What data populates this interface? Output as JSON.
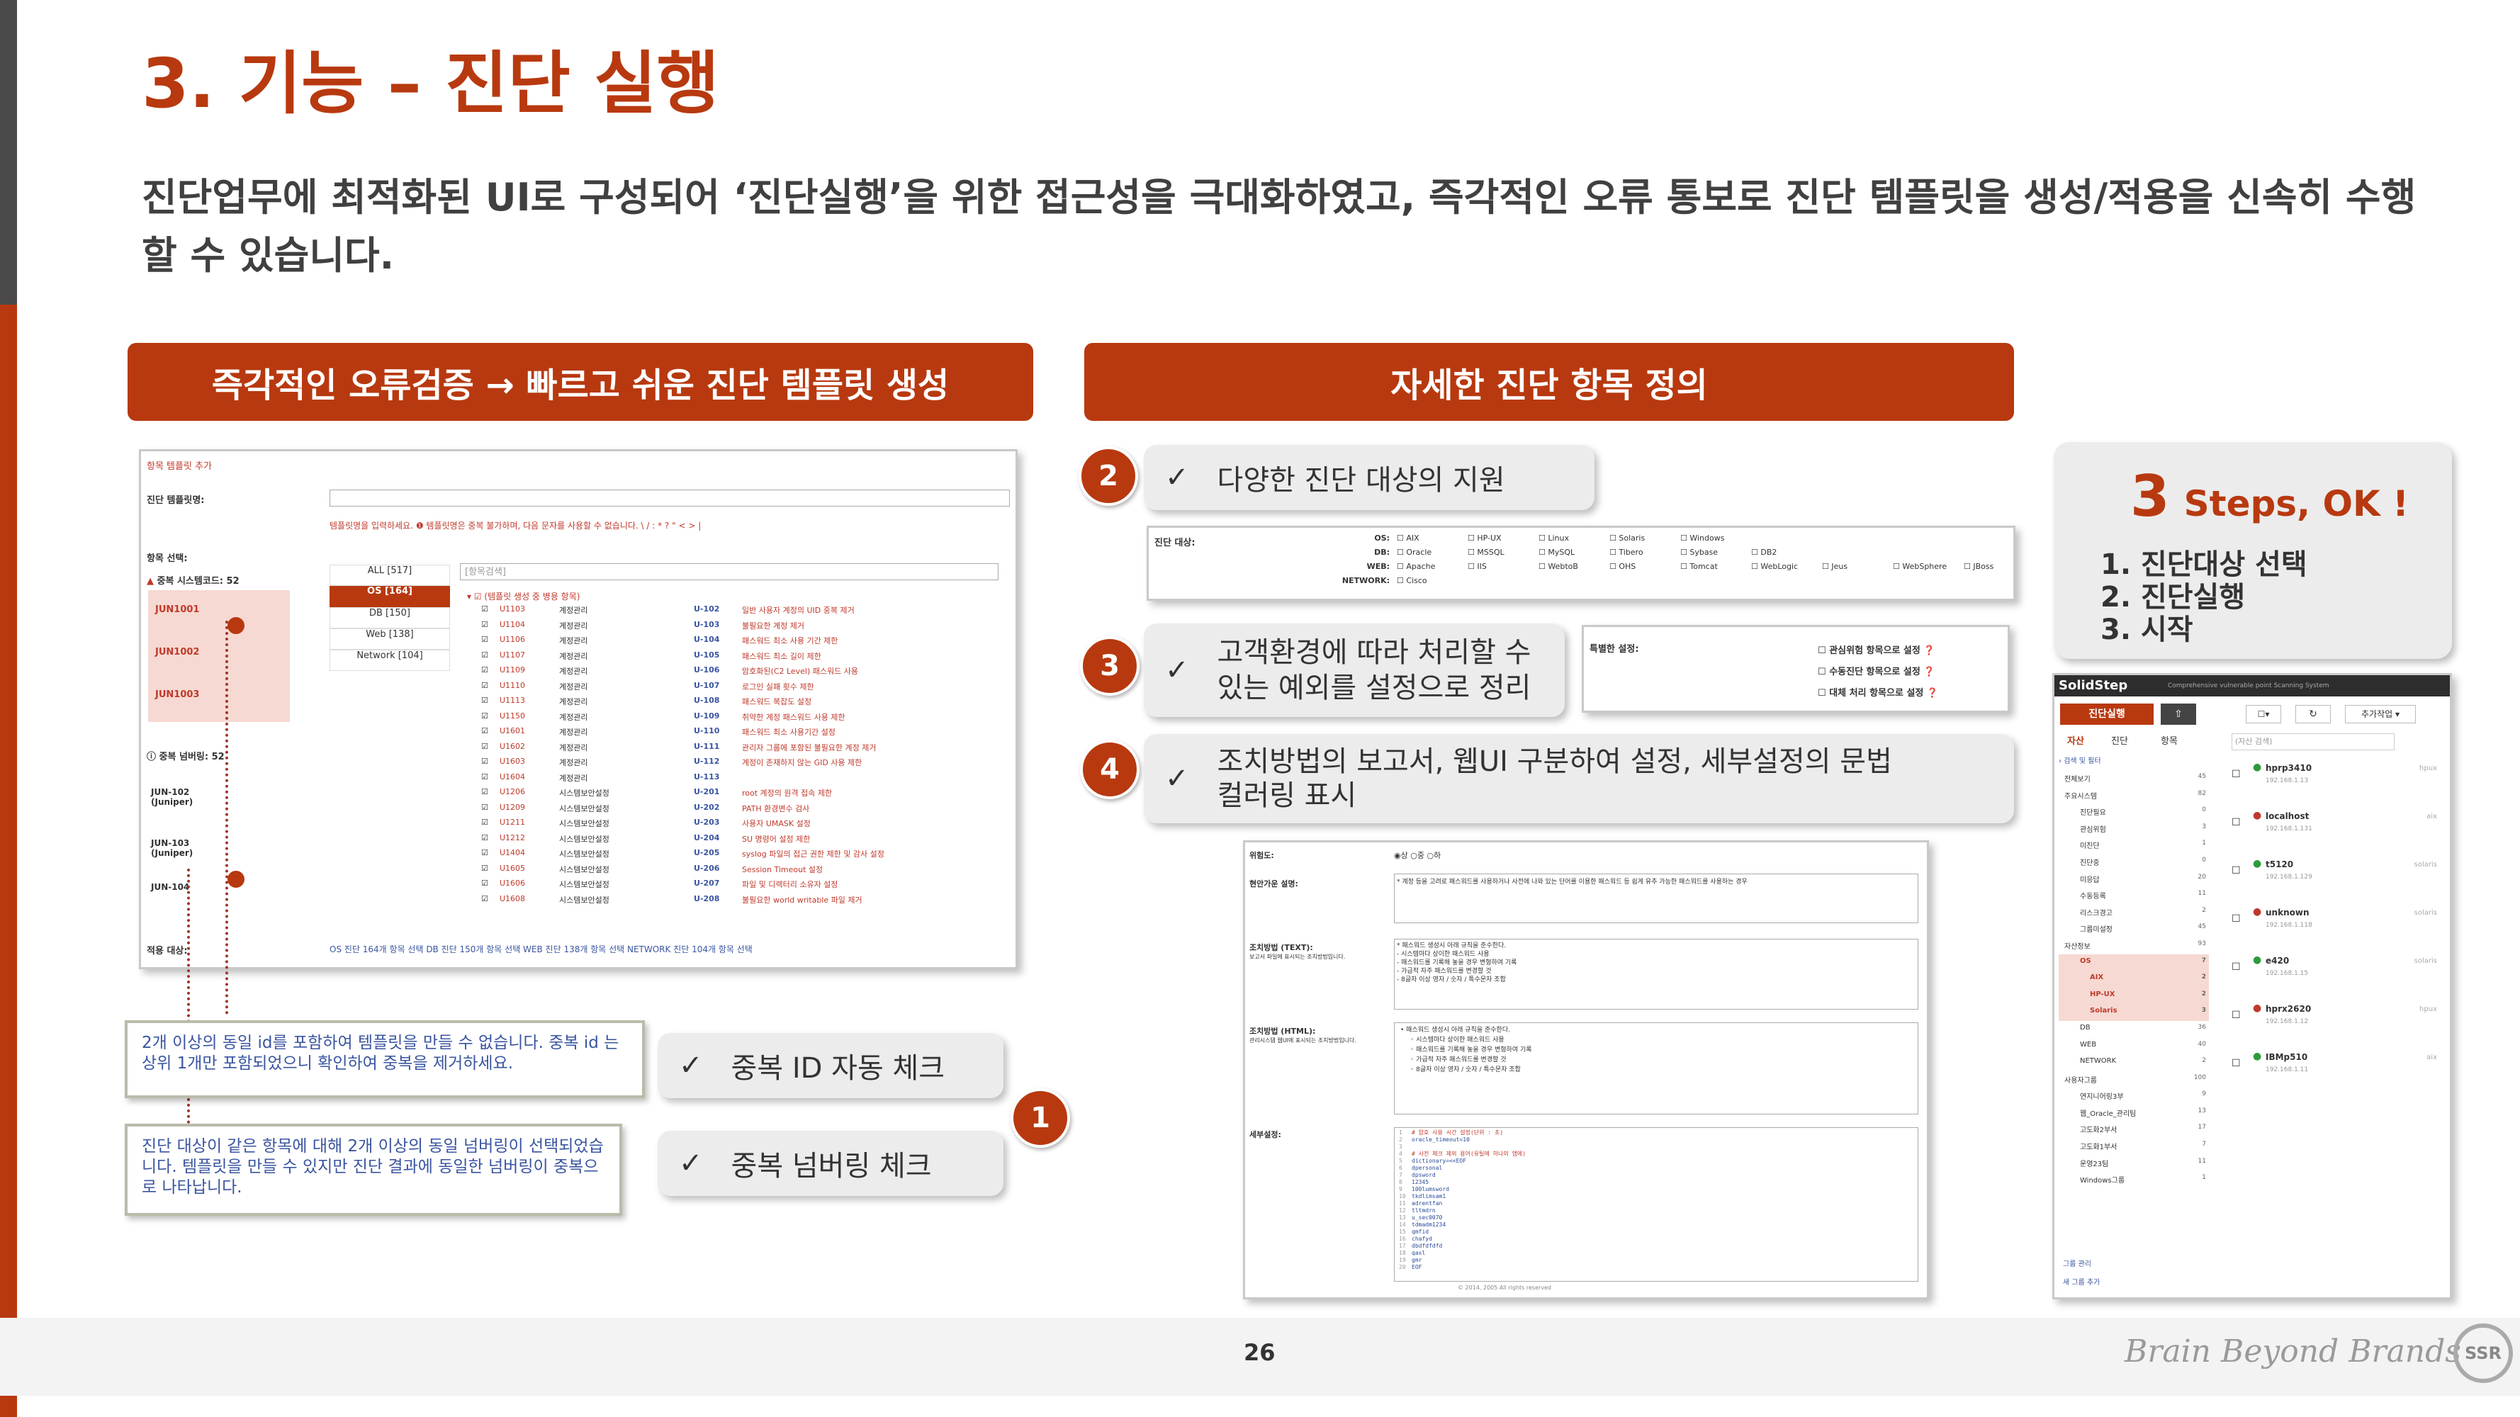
{
  "title": "3. 기능 – 진단 실행",
  "subtitle": "진단업무에 최적화된 UI로 구성되어 ‘진단실행’을 위한 접근성을 극대화하였고, 즉각적인 오류 통보로 진단 템플릿을 생성/적용을 신속히 수행할 수 있습니다.",
  "left_header": "즉각적인 오류검증 → 빠르고 쉬운 진단 템플릿 생성",
  "right_header": "자세한 진단 항목 정의",
  "template_screen": {
    "title": "항목 템플릿 추가",
    "name_label": "진단 템플릿명:",
    "name_hint": "템플릿명을 입력하세요. ❶ 템플릿명은 중복 불가하며, 다음 문자를 사용할 수 없습니다.",
    "name_hint_chars": "\\ / : * ? \" < > |",
    "item_select_label": "항목 선택:",
    "dup_code_label": "중복 시스템코드: 52",
    "dup_num_label": "중복 넘버링: 52",
    "search_placeholder": "[항목검색]",
    "tree_root": "(템플릿 생성 중 병용 항목)",
    "categories": [
      "ALL [517]",
      "OS [164]",
      "DB [150]",
      "Web [138]",
      "Network [104]"
    ],
    "dup_codes": [
      "JUN1001",
      "JUN1002",
      "JUN1003"
    ],
    "dup_nums": [
      "JUN-102 (Juniper)",
      "JUN-103 (Juniper)",
      "JUN-104"
    ],
    "apply_label": "적용 대상:",
    "apply_text": "OS 진단 164개 항목 선택 DB 진단 150개 항목 선택 WEB 진단 138개 항목 선택 NETWORK 진단 104개 항목 선택",
    "rows": [
      [
        "U1103",
        "계정관리",
        "U-102",
        "일반 사용자 계정의 UID 중복 제거"
      ],
      [
        "U1104",
        "계정관리",
        "U-103",
        "불필요한 계정 제거"
      ],
      [
        "U1106",
        "계정관리",
        "U-104",
        "패스워드 최소 사용 기간 제한"
      ],
      [
        "U1107",
        "계정관리",
        "U-105",
        "패스워드 최소 길이 제한"
      ],
      [
        "U1109",
        "계정관리",
        "U-106",
        "암호화된(C2 Level) 패스워드 사용"
      ],
      [
        "U1110",
        "계정관리",
        "U-107",
        "로그인 실패 횟수 제한"
      ],
      [
        "U1113",
        "계정관리",
        "U-108",
        "패스워드 복잡도 설정"
      ],
      [
        "U1150",
        "계정관리",
        "U-109",
        "취약한 계정 패스워드 사용 제한"
      ],
      [
        "U1601",
        "계정관리",
        "U-110",
        "패스워드 최소 사용기간 설정"
      ],
      [
        "U1602",
        "계정관리",
        "U-111",
        "관리자 그룹에 포함된 불필요한 계정 제거"
      ],
      [
        "U1603",
        "계정관리",
        "U-112",
        "계정이 존재하지 않는 GID 사용 제한"
      ],
      [
        "U1604",
        "계정관리",
        "U-113",
        ""
      ],
      [
        "U1206",
        "시스템보안설정",
        "U-201",
        "root 계정의 원격 접속 제한"
      ],
      [
        "U1209",
        "시스템보안설정",
        "U-202",
        "PATH 환경변수 검사"
      ],
      [
        "U1211",
        "시스템보안설정",
        "U-203",
        "사용자 UMASK 설정"
      ],
      [
        "U1212",
        "시스템보안설정",
        "U-204",
        "SU 명령어 설정 제한"
      ],
      [
        "U1404",
        "시스템보안설정",
        "U-205",
        "syslog 파일의 접근 권한 제한 및 감사 설정"
      ],
      [
        "U1605",
        "시스템보안설정",
        "U-206",
        "Session Timeout 설정"
      ],
      [
        "U1606",
        "시스템보안설정",
        "U-207",
        "파일 및 디렉터리 소유자 설정"
      ],
      [
        "U1608",
        "시스템보안설정",
        "U-208",
        "불필요한 world writable 파일 제거"
      ]
    ]
  },
  "note1": "2개 이상의 동일 id를 포함하여 템플릿을 만들 수 없습니다. 중복 id 는 상위 1개만 포함되었으니 확인하여 중복을 제거하세요.",
  "note2": "진단 대상이 같은 항목에 대해 2개 이상의 동일 넘버링이 선택되었습니다. 템플릿을 만들 수 있지만 진단 결과에 동일한 넘버링이 중복으로 나타납니다.",
  "callout_dup_id": "중복 ID 자동 체크",
  "callout_dup_num": "중복 넘버링 체크",
  "callout_targets": "다양한 진단 대상의 지원",
  "callout_exceptions_1": "고객환경에 따라 처리할 수",
  "callout_exceptions_2": "있는 예외를 설정으로 정리",
  "callout_report_1": "조치방법의 보고서, 웹UI 구분하여 설정, 세부설정의 문법",
  "callout_report_2": "컬러링 표시",
  "badges": [
    "1",
    "2",
    "3",
    "4"
  ],
  "targets_screen": {
    "label": "진단 대상:",
    "rows": [
      {
        "key": "OS:",
        "items": [
          "AIX",
          "HP-UX",
          "Linux",
          "Solaris",
          "Windows"
        ]
      },
      {
        "key": "DB:",
        "items": [
          "Oracle",
          "MSSQL",
          "MySQL",
          "Tibero",
          "Sybase",
          "DB2"
        ]
      },
      {
        "key": "WEB:",
        "items": [
          "Apache",
          "IIS",
          "WebtoB",
          "OHS",
          "Tomcat",
          "WebLogic",
          "Jeus",
          "WebSphere",
          "JBoss"
        ]
      },
      {
        "key": "NETWORK:",
        "items": [
          "Cisco"
        ]
      }
    ]
  },
  "special_screen": {
    "label": "특별한 설정:",
    "options": [
      "관심위험 항목으로 설정",
      "수동진단 항목으로 설정",
      "대체 처리 항목으로 설정"
    ]
  },
  "detail_screen": {
    "risk_label": "위험도:",
    "risk_options": [
      "상",
      "중",
      "하"
    ],
    "desc_label": "현안가운 설명:",
    "desc_text": "* 계정 등을 고려로 패스워드를 사용하거나 사전에 나와 있는 단어를 이용한 패스워드 등 쉽게 유추 가능한 패스워드를 사용하는 경우",
    "text_label": "조치방법 (TEXT):",
    "text_sub": "보고서 파일에 표시되는 조치방법입니다.",
    "text_lines": [
      "* 패스워드 생성시 아래 규칙을 준수한다.",
      "- 시스템마다 상이한 패스워드 사용",
      "- 패스워드를 기록해 놓을 경우 변형하여 기록",
      "- 가급적 자주 패스워드를 변경할 것",
      "- 8글자 이상 영자 / 숫자 / 특수문자 조합"
    ],
    "html_label": "조치방법 (HTML):",
    "html_sub": "관리시스템 웹UI에 표시되는 조치방법입니다.",
    "html_lines": [
      "• 패스워드 생성시 아래 규칙을 준수한다.",
      "◦ 시스템마다 상이한 패스워드 사용",
      "◦ 패스워드를 기록해 놓을 경우 변형하여 기록",
      "◦ 가급적 자주 패스워드를 변경할 것",
      "◦ 8글자 이상 영자 / 숫자 / 특수문자 조합"
    ],
    "detail_label": "세부설정:",
    "code_lines": [
      "# 암호 사용 시간 설정(단위 : 초)",
      "oracle_timeout=10",
      "",
      "# 사전 체크 제외 용어(유틸에 하나의 앱에)",
      "dictionary=<<EOF",
      "dpersonal",
      "dpsword",
      "12345",
      "100lumsword",
      "tkdlimsam1",
      "adrentfan",
      "tltmdrn",
      "u_sec0070",
      "tdmadm1234",
      "qmfid",
      "chafyd",
      "dbdfdfdfd",
      "qasl",
      "gmr",
      "EOF"
    ],
    "copyright": "© 2014, 2005 All rights reserved"
  },
  "steps": {
    "number": "3",
    "title": "Steps,   OK !",
    "items": [
      "1.  진단대상 선택",
      "2.  진단실행",
      "3.  시작"
    ]
  },
  "solidstep": {
    "brand": "SolidStep",
    "tagline": "Comprehensive vulnerable point Scanning System",
    "run_button": "진단실행",
    "add_button": "추가작업",
    "tabs": [
      "자산",
      "진단",
      "항목"
    ],
    "search_placeholder": "(자산 검색)",
    "filter": "검색 및 필터",
    "tree": [
      {
        "label": "전체보기",
        "count": "45"
      },
      {
        "label": "주요시스템",
        "count": "82"
      },
      {
        "label": "진단필요",
        "count": "0"
      },
      {
        "label": "관심위험",
        "count": "3"
      },
      {
        "label": "미진단",
        "count": "1"
      },
      {
        "label": "진단중",
        "count": "0"
      },
      {
        "label": "미응답",
        "count": "20"
      },
      {
        "label": "수동등록",
        "count": "11"
      },
      {
        "label": "리스크경고",
        "count": "2"
      },
      {
        "label": "그룹미설정",
        "count": "45"
      },
      {
        "label": "자산정보",
        "count": "93"
      },
      {
        "label": "OS",
        "count": "7"
      },
      {
        "label": "AIX",
        "count": "2"
      },
      {
        "label": "HP-UX",
        "count": "2"
      },
      {
        "label": "Solaris",
        "count": "3"
      },
      {
        "label": "DB",
        "count": "36"
      },
      {
        "label": "WEB",
        "count": "40"
      },
      {
        "label": "NETWORK",
        "count": "2"
      },
      {
        "label": "사용자그룹",
        "count": "100"
      },
      {
        "label": "연지니어링3부",
        "count": "9"
      },
      {
        "label": "웹_Oracle_관리팀",
        "count": "13"
      },
      {
        "label": "고도화2부서",
        "count": "17"
      },
      {
        "label": "고도화1부서",
        "count": "7"
      },
      {
        "label": "운영23팀",
        "count": "11"
      },
      {
        "label": "Windows그룹",
        "count": "1"
      }
    ],
    "group_manage": "그룹 관리",
    "group_add": "새 그룹 추가",
    "assets": [
      {
        "name": "hprp3410",
        "ip": "192.168.1.13",
        "os": "hpux",
        "status": "#2e9b3a"
      },
      {
        "name": "localhost",
        "ip": "192.168.1.131",
        "os": "aix",
        "status": "#c0392b"
      },
      {
        "name": "t5120",
        "ip": "192.168.1.129",
        "os": "solaris",
        "status": "#2e9b3a"
      },
      {
        "name": "unknown",
        "ip": "192.168.1.118",
        "os": "solaris",
        "status": "#c0392b"
      },
      {
        "name": "e420",
        "ip": "192.168.1.15",
        "os": "solaris",
        "status": "#2e9b3a"
      },
      {
        "name": "hprx2620",
        "ip": "192.168.1.12",
        "os": "hpux",
        "status": "#c0392b"
      },
      {
        "name": "IBMp510",
        "ip": "192.168.1.11",
        "os": "aix",
        "status": "#2e9b3a"
      }
    ]
  },
  "page_number": "26",
  "brand_footer": "Brain Beyond Brands",
  "logo_text": "SSR",
  "colors": {
    "accent": "#b8390f",
    "dark": "#4a4a4a",
    "callout_bg": "#ececec"
  }
}
